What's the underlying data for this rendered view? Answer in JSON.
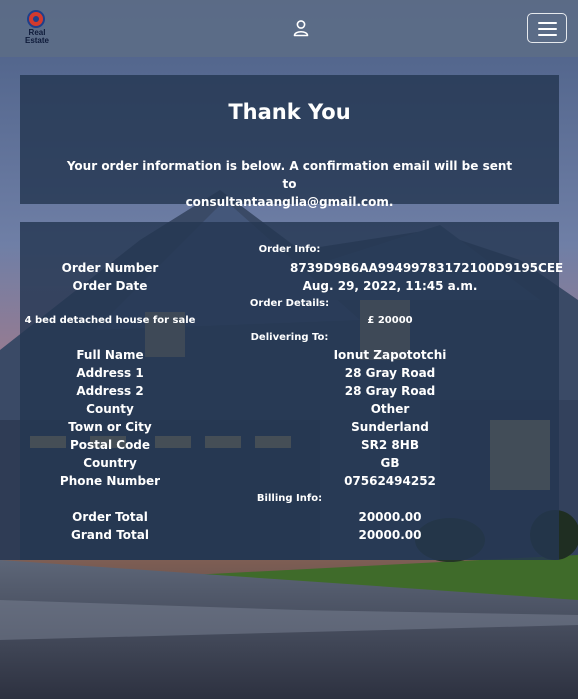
{
  "brand": {
    "logo_text_line1": "Real",
    "logo_text_line2": "Estate"
  },
  "colors": {
    "navbar": "#5c6c87",
    "panel": "#253752",
    "logo_red": "#d23a2e",
    "logo_blue": "#1f3f8a"
  },
  "icons": {
    "user": "user-icon",
    "menu": "hamburger-menu-icon"
  },
  "thank_you": {
    "title": "Thank You",
    "message_line1": "Your order information is below. A confirmation email will be sent to",
    "message_line2": "consultantaanglia@gmail.com."
  },
  "order_info": {
    "heading": "Order Info:",
    "order_number_label": "Order Number",
    "order_number": "8739D9B6AA99499783172100D9195CEE",
    "order_date_label": "Order Date",
    "order_date": "Aug. 29, 2022, 11:45 a.m."
  },
  "order_details": {
    "heading": "Order Details:",
    "item_name": "4 bed detached house for sale",
    "item_price": "£ 20000"
  },
  "delivering_to": {
    "heading": "Delivering To:",
    "rows": [
      {
        "label": "Full Name",
        "value": "Ionut Zapototchi"
      },
      {
        "label": "Address 1",
        "value": "28 Gray Road"
      },
      {
        "label": "Address 2",
        "value": "28 Gray Road"
      },
      {
        "label": "County",
        "value": "Other"
      },
      {
        "label": "Town or City",
        "value": "Sunderland"
      },
      {
        "label": "Postal Code",
        "value": "SR2 8HB"
      },
      {
        "label": "Country",
        "value": "GB"
      },
      {
        "label": "Phone Number",
        "value": "07562494252"
      }
    ]
  },
  "billing_info": {
    "heading": "Billing Info:",
    "order_total_label": "Order Total",
    "order_total": "20000.00",
    "grand_total_label": "Grand Total",
    "grand_total": "20000.00"
  }
}
